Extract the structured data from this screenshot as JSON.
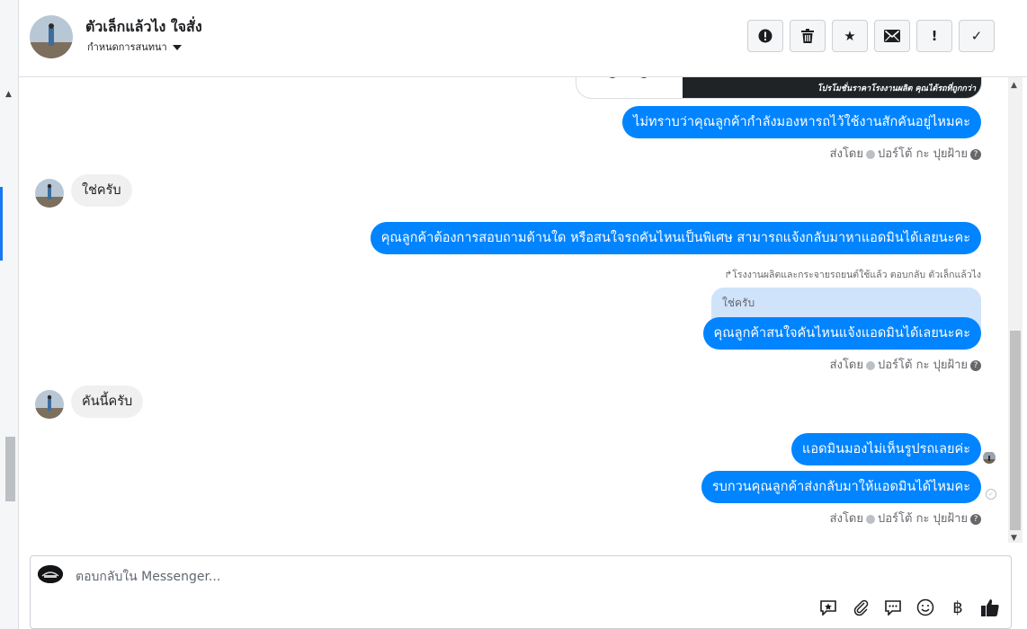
{
  "header": {
    "contact_name": "ตัวเล็กแล้วไง ใจสั่ง",
    "assign_label": "กำหนดการสนทนา",
    "toolbar": [
      {
        "name": "spam-button",
        "icon": "alert-circle-icon",
        "glyph": "!"
      },
      {
        "name": "delete-button",
        "icon": "trash-icon",
        "glyph": ""
      },
      {
        "name": "star-button",
        "icon": "star-icon",
        "glyph": "★"
      },
      {
        "name": "mark-unread-button",
        "icon": "envelope-icon",
        "glyph": ""
      },
      {
        "name": "follow-up-button",
        "icon": "exclamation-icon",
        "glyph": "!"
      },
      {
        "name": "done-button",
        "icon": "check-icon",
        "glyph": "✓"
      }
    ]
  },
  "conversation": {
    "attachment_promo": "โปรโมชั่นราคาโรงงานผลิต คุณได้รถที่ถูกกว่า",
    "messages": [
      {
        "text": "ไม่ทราบว่าคุณลูกค้ากำลังมองหารถไว้ใช้งานสักคันอยู่ไหมคะ"
      },
      {
        "text": "ใช่ครับ"
      },
      {
        "text": "คุณลูกค้าต้องการสอบถามด้านใด หรือสนใจรถคันไหนเป็นพิเศษ สามารถแจ้งกลับมาหาแอดมินได้เลยนะคะ"
      },
      {
        "text": "คุณลูกค้าสนใจคันไหนแจ้งแอดมินได้เลยนะคะ"
      },
      {
        "text": "คันนี้ครับ"
      },
      {
        "text": "แอดมินมองไม่เห็นรูปรถเลยค่ะ"
      },
      {
        "text": "รบกวนคุณลูกค้าส่งกลับมาให้แอดมินได้ไหมคะ"
      }
    ],
    "sent_by_label": "ส่งโดย",
    "sender_name": "ปอร์โต้ กะ ปุยฝ้าย",
    "reply_note": "โรงงานผลิตและกระจายรถยนต์ใช้แล้ว ตอบกลับ ตัวเล็กแล้วไง",
    "quoted_text": "ใช่ครับ"
  },
  "composer": {
    "placeholder": "ตอบกลับใน Messenger...",
    "tools": [
      {
        "name": "saved-reply-button",
        "icon": "saved-reply-icon"
      },
      {
        "name": "attach-button",
        "icon": "paperclip-icon"
      },
      {
        "name": "chat-bubble-button",
        "icon": "chat-bubble-icon"
      },
      {
        "name": "emoji-button",
        "icon": "smiley-icon"
      },
      {
        "name": "payment-button",
        "icon": "baht-icon",
        "glyph": "฿"
      },
      {
        "name": "like-button",
        "icon": "thumbs-up-icon"
      }
    ]
  },
  "colors": {
    "outgoing_bubble": "#0084ff",
    "incoming_bubble": "#f0f0f0",
    "quoted_bubble": "#cfe3fb",
    "accent": "#1877f2"
  }
}
